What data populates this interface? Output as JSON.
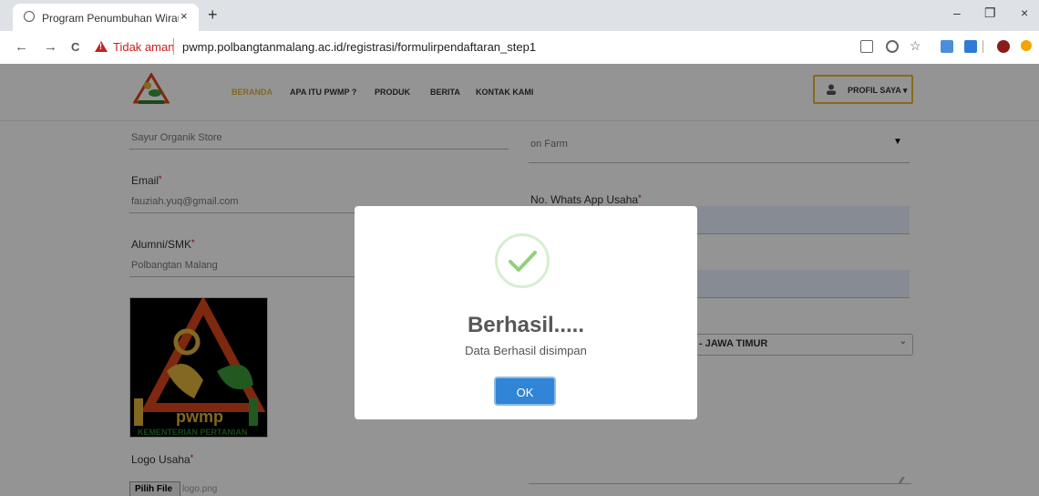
{
  "browser": {
    "tab_title": "Program Penumbuhan Wirausaha",
    "tab_close": "×",
    "new_tab": "+",
    "minimize": "–",
    "restore": "❐",
    "close": "×",
    "back": "←",
    "forward": "→",
    "reload": "C",
    "security_label": "Tidak aman",
    "url": "pwmp.polbangtanmalang.ac.id/registrasi/formulirpendaftaran_step1"
  },
  "header": {
    "menu": [
      "BERANDA",
      "APA ITU PWMP ?",
      "PRODUK",
      "BERITA",
      "KONTAK KAMI"
    ],
    "active_color": "#e0b43a",
    "profile_label": "PROFIL SAYA ▾",
    "accent": "#e8b72d"
  },
  "form": {
    "business_name_value": "Sayur Organik Store",
    "email_label": "Email",
    "email_value": "fauziah.yuq@gmail.com",
    "alumni_label": "Alumni/SMK",
    "alumni_value": "Polbangtan Malang",
    "logo_label": "Logo Usaha",
    "logo_text": "pwmp",
    "logo_caption": "KEMENTERIAN PERTANIAN",
    "file_button": "Pilih File",
    "file_name": "logo.png",
    "sector_value": "on Farm",
    "sector_caret": "▼",
    "whatsapp_label": "No. Whats App Usaha",
    "province_value": "- JAWA TIMUR",
    "select_caret": "⌄",
    "required_mark": "*"
  },
  "modal": {
    "title": "Berhasil.....",
    "message": "Data Berhasil disimpan",
    "ok_label": "OK",
    "success_color": "#8fd17a",
    "button_color": "#3085d6"
  }
}
